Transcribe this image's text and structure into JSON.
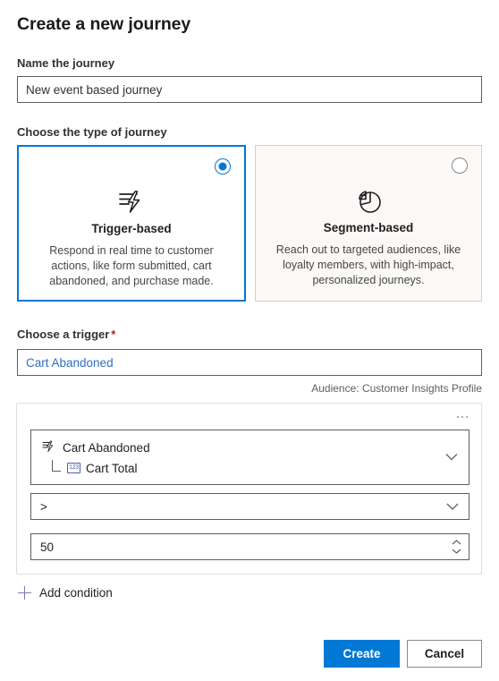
{
  "dialog": {
    "title": "Create a new journey"
  },
  "name_field": {
    "label": "Name the journey",
    "value": "New event based journey",
    "placeholder": "Name the journey"
  },
  "journey_type": {
    "label": "Choose the type of journey",
    "options": [
      {
        "id": "trigger-based",
        "icon": "lightning-lines-icon",
        "title": "Trigger-based",
        "description": "Respond in real time to customer actions, like form submitted, cart abandoned, and purchase made.",
        "selected": true
      },
      {
        "id": "segment-based",
        "icon": "pie-chart-icon",
        "title": "Segment-based",
        "description": "Reach out to targeted audiences, like loyalty members, with high-impact, personalized journeys.",
        "selected": false
      }
    ]
  },
  "trigger": {
    "label": "Choose a trigger",
    "required_marker": "*",
    "value": "Cart Abandoned",
    "audience_hint": "Audience: Customer Insights Profile"
  },
  "condition": {
    "overflow_label": "...",
    "attribute": {
      "source_icon": "lightning-lines-icon",
      "source": "Cart Abandoned",
      "field_icon": "number-type-icon",
      "field_icon_text": "123",
      "field": "Cart Total"
    },
    "operator": {
      "value": ">"
    },
    "value": {
      "value": "50"
    },
    "add_label": "Add condition"
  },
  "footer": {
    "create_label": "Create",
    "cancel_label": "Cancel"
  },
  "colors": {
    "accent": "#0078d4",
    "required": "#a4262c",
    "link": "#2f6fc0",
    "panel_border": "#e1dfdd",
    "input_border": "#605e5c"
  }
}
